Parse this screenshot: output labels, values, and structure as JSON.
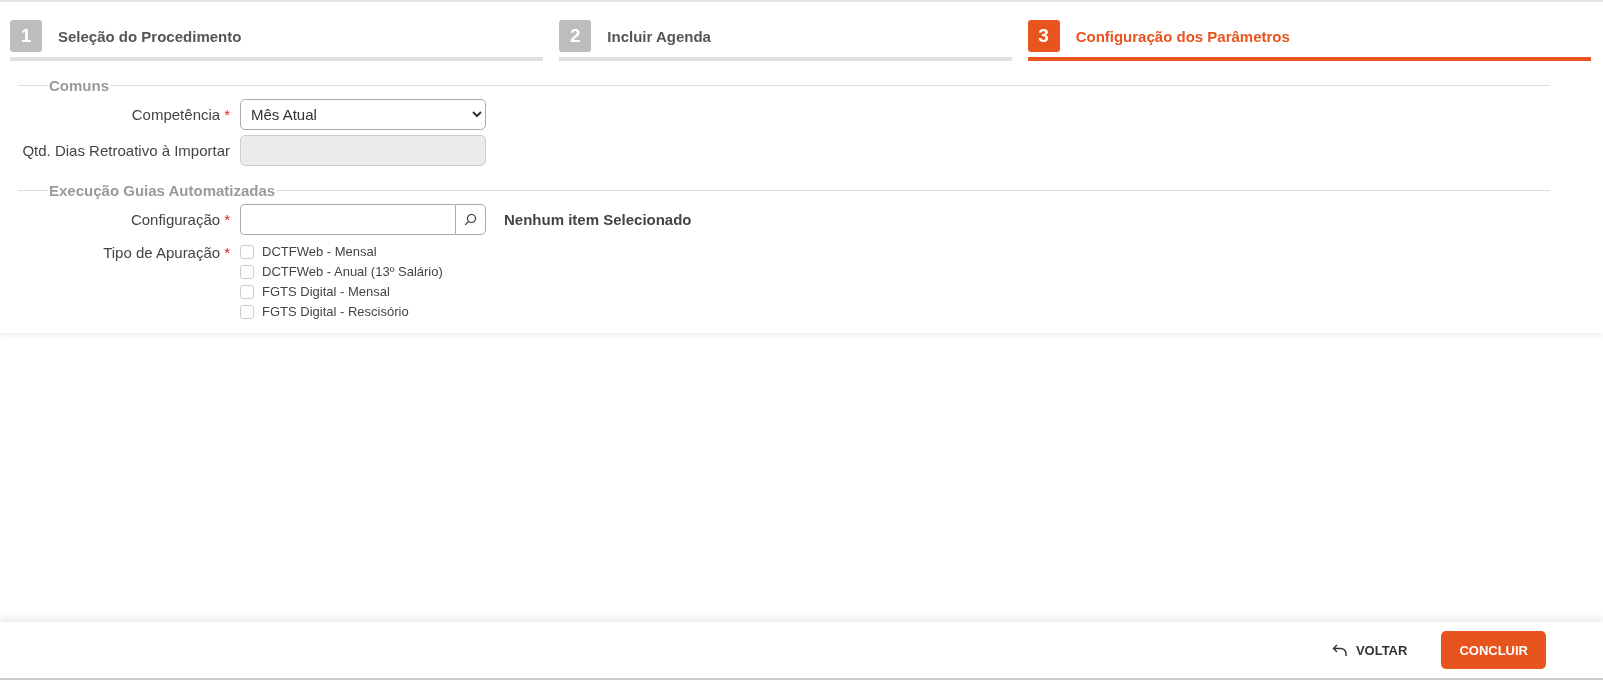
{
  "steps": [
    {
      "number": "1",
      "label": "Seleção do Procedimento",
      "selected": false
    },
    {
      "number": "2",
      "label": "Incluir Agenda",
      "selected": false
    },
    {
      "number": "3",
      "label": "Configuração dos Parâmetros",
      "selected": true
    }
  ],
  "sections": [
    {
      "legend": "Comuns",
      "fields": [
        {
          "kind": "select",
          "label": "Competência",
          "required_mark": "*",
          "value": "Mês Atual"
        },
        {
          "kind": "input",
          "label": "Qtd. Dias Retroativo à Importar",
          "disabled": true
        }
      ]
    },
    {
      "legend": "Execução Guias Automatizadas",
      "fields": [
        {
          "kind": "lookup",
          "label": "Configuração",
          "required_mark": "*",
          "selection": "Nenhum item Selecionado"
        },
        {
          "kind": "checkboxes",
          "label": "Tipo de Apuração",
          "required_mark": "*",
          "options": [
            {
              "label": "DCTFWeb - Mensal",
              "checked": false
            },
            {
              "label": "DCTFWeb - Anual (13º Salário)",
              "checked": false
            },
            {
              "label": "FGTS Digital - Mensal",
              "checked": false
            },
            {
              "label": "FGTS Digital - Rescisório",
              "checked": false
            }
          ]
        }
      ]
    }
  ],
  "footer": {
    "back": "VOLTAR",
    "primary": "CONCLUIR"
  }
}
